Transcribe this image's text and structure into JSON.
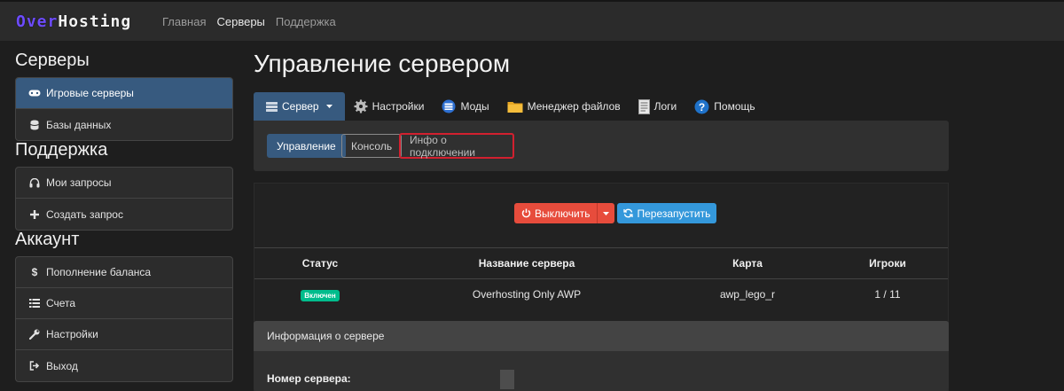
{
  "brand": {
    "accent": "Over",
    "rest": "Hosting"
  },
  "nav": {
    "links": [
      {
        "label": "Главная",
        "active": false
      },
      {
        "label": "Серверы",
        "active": true
      },
      {
        "label": "Поддержка",
        "active": false
      }
    ]
  },
  "sidebar": {
    "servers": {
      "title": "Серверы",
      "items": [
        {
          "label": "Игровые серверы",
          "icon": "gamepad-icon",
          "active": true
        },
        {
          "label": "Базы данных",
          "icon": "database-icon",
          "active": false
        }
      ]
    },
    "support": {
      "title": "Поддержка",
      "items": [
        {
          "label": "Мои запросы",
          "icon": "headset-icon"
        },
        {
          "label": "Создать запрос",
          "icon": "plus-icon"
        }
      ]
    },
    "account": {
      "title": "Аккаунт",
      "items": [
        {
          "label": "Пополнение баланса",
          "icon": "dollar-icon"
        },
        {
          "label": "Счета",
          "icon": "list-icon"
        },
        {
          "label": "Настройки",
          "icon": "wrench-icon"
        },
        {
          "label": "Выход",
          "icon": "sign-out-icon"
        }
      ]
    }
  },
  "main": {
    "title": "Управление сервером",
    "tabs": [
      {
        "label": "Сервер",
        "icon": "server-icon",
        "active": true
      },
      {
        "label": "Настройки",
        "icon": "gear-icon"
      },
      {
        "label": "Моды",
        "icon": "mods-icon"
      },
      {
        "label": "Менеджер файлов",
        "icon": "folder-icon"
      },
      {
        "label": "Логи",
        "icon": "document-icon"
      },
      {
        "label": "Помощь",
        "icon": "help-icon"
      }
    ],
    "subtabs": {
      "manage": "Управление",
      "console": "Консоль",
      "connection_info": "Инфо о подключении"
    },
    "actions": {
      "stop": "Выключить",
      "restart": "Перезапустить"
    },
    "table": {
      "headers": [
        "Статус",
        "Название сервера",
        "Карта",
        "Игроки"
      ],
      "row": {
        "status": "Включен",
        "name": "Overhosting Only AWP",
        "map": "awp_lego_r",
        "players": "1 / 11"
      }
    },
    "info": {
      "title": "Информация о сервере",
      "server_number_label": "Номер сервера:"
    }
  },
  "colors": {
    "primary": "#375a7f",
    "danger": "#e74c3c",
    "info": "#3498db",
    "success": "#00bc8c",
    "highlight": "#d2202f",
    "brand_accent": "#6d4cff"
  }
}
